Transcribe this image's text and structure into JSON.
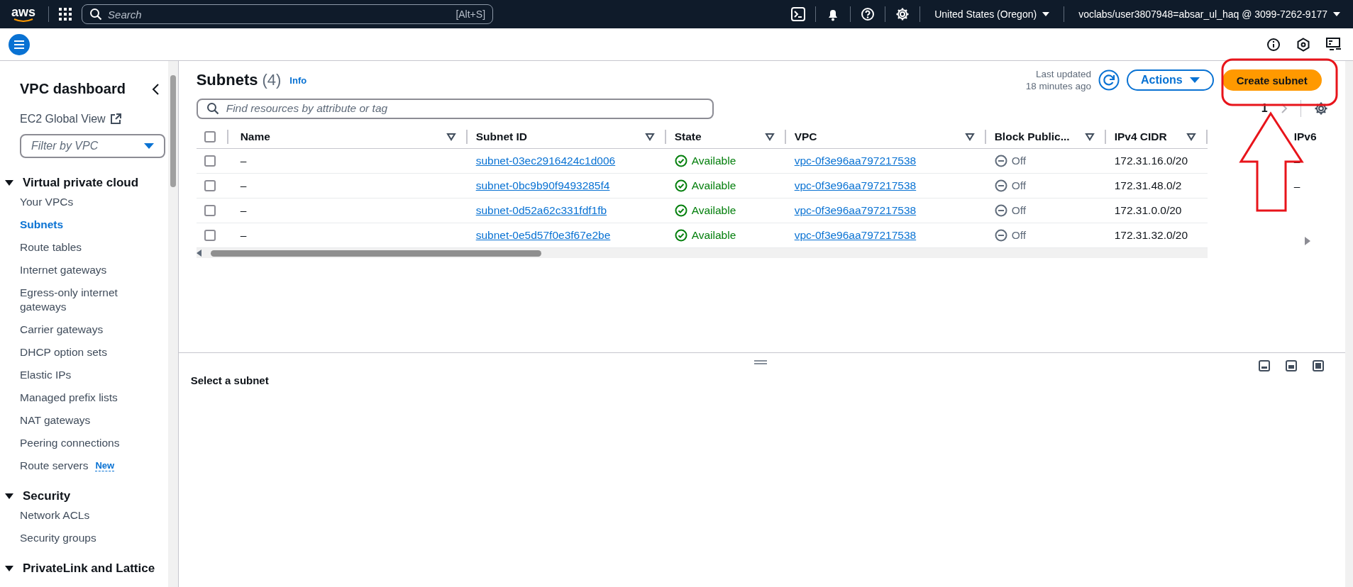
{
  "top_bar": {
    "logo": "aws",
    "search": {
      "placeholder": "Search",
      "shortcut": "[Alt+S]"
    },
    "region": "United States (Oregon)",
    "account": "voclabs/user3807948=absar_ul_haq @ 3099-7262-9177"
  },
  "sidebar": {
    "title": "VPC dashboard",
    "global_view": "EC2 Global View",
    "filter": {
      "placeholder": "Filter by VPC"
    },
    "sections": [
      {
        "label": "Virtual private cloud",
        "expanded": true,
        "children": [
          {
            "label": "Your VPCs",
            "selected": false
          },
          {
            "label": "Subnets",
            "selected": true
          },
          {
            "label": "Route tables",
            "selected": false
          },
          {
            "label": "Internet gateways",
            "selected": false
          },
          {
            "label": "Egress-only internet gateways",
            "selected": false
          },
          {
            "label": "Carrier gateways",
            "selected": false
          },
          {
            "label": "DHCP option sets",
            "selected": false
          },
          {
            "label": "Elastic IPs",
            "selected": false
          },
          {
            "label": "Managed prefix lists",
            "selected": false
          },
          {
            "label": "NAT gateways",
            "selected": false
          },
          {
            "label": "Peering connections",
            "selected": false
          },
          {
            "label": "Route servers",
            "selected": false,
            "badge": "New"
          }
        ]
      },
      {
        "label": "Security",
        "expanded": true,
        "children": [
          {
            "label": "Network ACLs",
            "selected": false
          },
          {
            "label": "Security groups",
            "selected": false
          }
        ]
      },
      {
        "label": "PrivateLink and Lattice",
        "expanded": true
      }
    ]
  },
  "subnets": {
    "title": "Subnets",
    "count": "(4)",
    "info": "Info",
    "last_updated_label": "Last updated",
    "last_updated_time": "18 minutes ago",
    "actions": "Actions",
    "create": "Create subnet",
    "search": {
      "placeholder": "Find resources by attribute or tag"
    },
    "page": "1",
    "table": {
      "select_all_checked": false,
      "columns": [
        {
          "label": "Name"
        },
        {
          "label": "Subnet ID"
        },
        {
          "label": "State"
        },
        {
          "label": "VPC"
        },
        {
          "label": "Block Public..."
        },
        {
          "label": "IPv4 CIDR"
        },
        {
          "label": "IPv6"
        }
      ],
      "rows": [
        {
          "checked": false,
          "name": "–",
          "subnet_id": "subnet-03ec2916424c1d006",
          "state": "Available",
          "kind": "available",
          "vpc": "vpc-0f3e96aa797217538",
          "block": "Off",
          "ipv4": "172.31.16.0/20",
          "ipv6": "–"
        },
        {
          "checked": false,
          "name": "–",
          "subnet_id": "subnet-0bc9b90f9493285f4",
          "state": "Available",
          "kind": "available",
          "vpc": "vpc-0f3e96aa797217538",
          "block": "Off",
          "ipv4": "172.31.48.0/2",
          "ipv6": "–"
        },
        {
          "checked": false,
          "name": "–",
          "subnet_id": "subnet-0d52a62c331fdf1fb",
          "state": "Available",
          "kind": "available",
          "vpc": "vpc-0f3e96aa797217538",
          "block": "Off",
          "ipv4": "172.31.0.0/20"
        },
        {
          "checked": false,
          "name": "–",
          "subnet_id": "subnet-0e5d57f0e3f67e2be",
          "state": "Available",
          "kind": "available",
          "vpc": "vpc-0f3e96aa797217538",
          "block": "Off",
          "ipv4": "172.31.32.0/20"
        }
      ]
    }
  },
  "details": {
    "title": "Select a subnet"
  }
}
